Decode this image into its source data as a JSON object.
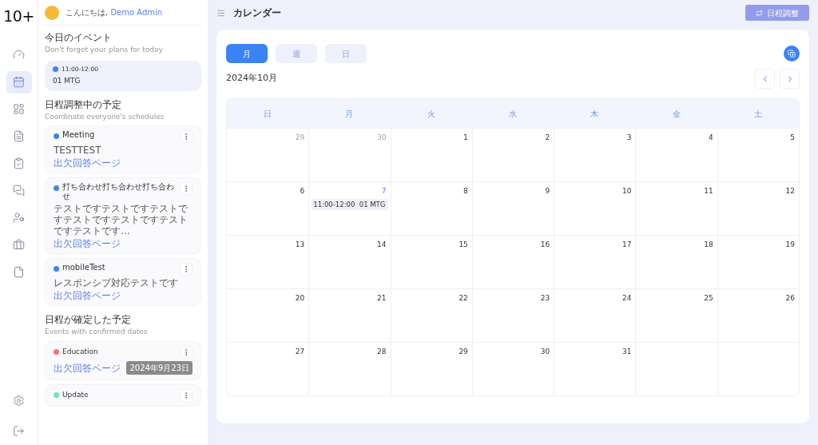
{
  "logo": "10+",
  "nav": [
    {
      "selected": false
    },
    {
      "selected": true
    },
    {
      "selected": false
    },
    {
      "selected": false
    },
    {
      "selected": false
    },
    {
      "selected": false
    },
    {
      "selected": false
    },
    {
      "selected": false
    },
    {
      "selected": false
    }
  ],
  "greeting": {
    "text": "こんにちは,",
    "name": "Demo Admin"
  },
  "today": {
    "title": "今日のイベント",
    "subtitle": "Don't forget your plans for today",
    "events": [
      {
        "time": "11:00-12:00",
        "title": "01 MTG",
        "color": "#3b82f6"
      }
    ]
  },
  "coordinating": {
    "title": "日程調整中の予定",
    "subtitle": "Coordinate everyone's schedules",
    "items": [
      {
        "title": "Meeting",
        "color": "#3b82f6",
        "description": "TESTTEST",
        "link": "出欠回答ページ"
      },
      {
        "title": "打ち合わせ打ち合わせ打ち合わせ",
        "color": "#3b82f6",
        "description": "テストですテストですテストですテストですテストですテストですテストです…",
        "link": "出欠回答ページ"
      },
      {
        "title": "mobileTest",
        "color": "#3b82f6",
        "description": "レスポンシブ対応テストです",
        "link": "出欠回答ページ"
      }
    ]
  },
  "confirmed": {
    "title": "日程が確定した予定",
    "subtitle": "Events with confirmed dates",
    "items": [
      {
        "title": "Education",
        "color": "#f87171",
        "link": "出欠回答ページ",
        "date": "2024年9月23日"
      },
      {
        "title": "Update",
        "color": "#6ee7b7"
      }
    ]
  },
  "header": {
    "title": "カレンダー",
    "button": "日程調整"
  },
  "calendar": {
    "views": [
      {
        "label": "月",
        "selected": true
      },
      {
        "label": "週",
        "selected": false
      },
      {
        "label": "日",
        "selected": false
      }
    ],
    "month": "2024年10月",
    "weekdays": [
      "日",
      "月",
      "火",
      "水",
      "木",
      "金",
      "土"
    ],
    "weeks": [
      [
        {
          "day": "29",
          "muted": true
        },
        {
          "day": "30",
          "muted": true
        },
        {
          "day": "1"
        },
        {
          "day": "2"
        },
        {
          "day": "3"
        },
        {
          "day": "4"
        },
        {
          "day": "5"
        }
      ],
      [
        {
          "day": "6"
        },
        {
          "day": "7",
          "today": true,
          "events": [
            {
              "time": "11:00-12:00",
              "title": "01 MTG"
            }
          ]
        },
        {
          "day": "8"
        },
        {
          "day": "9"
        },
        {
          "day": "10"
        },
        {
          "day": "11"
        },
        {
          "day": "12"
        }
      ],
      [
        {
          "day": "13"
        },
        {
          "day": "14"
        },
        {
          "day": "15"
        },
        {
          "day": "16"
        },
        {
          "day": "17"
        },
        {
          "day": "18"
        },
        {
          "day": "19"
        }
      ],
      [
        {
          "day": "20"
        },
        {
          "day": "21"
        },
        {
          "day": "22"
        },
        {
          "day": "23"
        },
        {
          "day": "24"
        },
        {
          "day": "25"
        },
        {
          "day": "26"
        }
      ],
      [
        {
          "day": "27"
        },
        {
          "day": "28"
        },
        {
          "day": "29"
        },
        {
          "day": "30"
        },
        {
          "day": "31"
        }
      ]
    ]
  }
}
